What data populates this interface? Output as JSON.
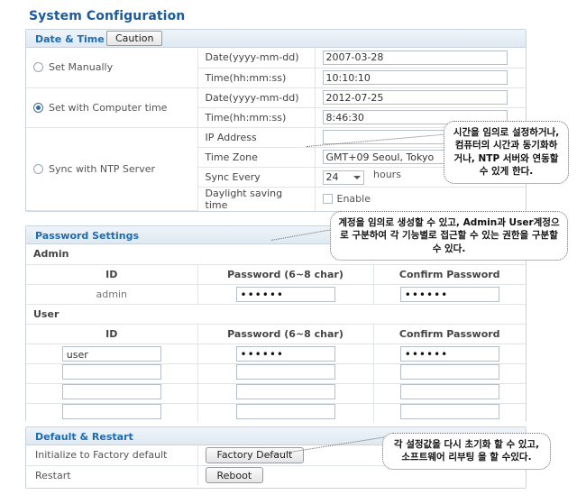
{
  "page": {
    "title": "System Configuration"
  },
  "datetime": {
    "panel_title": "Date & Time",
    "caution_label": "Caution",
    "modes": {
      "manual": "Set Manually",
      "computer": "Set with Computer time",
      "ntp": "Sync with NTP Server"
    },
    "labels": {
      "date": "Date(yyyy-mm-dd)",
      "time": "Time(hh:mm:ss)",
      "ip_address": "IP Address",
      "time_zone": "Time Zone",
      "sync_every": "Sync Every",
      "daylight": "Daylight saving time"
    },
    "values": {
      "manual_date": "2007-03-28",
      "manual_time": "10:10:10",
      "computer_date": "2012-07-25",
      "computer_time": "8:46:30",
      "ntp_ip": "",
      "time_zone": "GMT+09 Seoul, Tokyo",
      "sync_every": "24",
      "sync_units": "hours",
      "daylight_label": "Enable"
    }
  },
  "password": {
    "panel_title": "Password Settings",
    "admin_section": "Admin",
    "user_section": "User",
    "columns": {
      "id": "ID",
      "password": "Password (6~8 char)",
      "confirm": "Confirm Password"
    },
    "admin_rows": [
      {
        "id": "admin",
        "id_readonly": true,
        "password": "••••••",
        "confirm": "••••••"
      }
    ],
    "user_rows": [
      {
        "id": "user",
        "id_readonly": false,
        "password": "••••••",
        "confirm": "••••••"
      },
      {
        "id": "",
        "id_readonly": false,
        "password": "",
        "confirm": ""
      },
      {
        "id": "",
        "id_readonly": false,
        "password": "",
        "confirm": ""
      },
      {
        "id": "",
        "id_readonly": false,
        "password": "",
        "confirm": ""
      }
    ]
  },
  "default_restart": {
    "panel_title": "Default & Restart",
    "rows": [
      {
        "label": "Initialize to Factory default",
        "button": "Factory Default"
      },
      {
        "label": "Restart",
        "button": "Reboot"
      }
    ]
  },
  "callouts": [
    {
      "text": "시간을 임의로 설정하거나, 컴퓨터의 시간과 동기화하거나, NTP 서버와 연동할 수 있게 한다."
    },
    {
      "text": "계정을 임의로 생성할 수 있고, Admin과 User계정으로 구분하여 각 기능별로 접근할 수 있는 권한을 구분할 수 있다."
    },
    {
      "text": "각 설정값을 다시 초기화 할 수 있고, 소프트웨어 리부팅 을 할 수있다."
    }
  ]
}
